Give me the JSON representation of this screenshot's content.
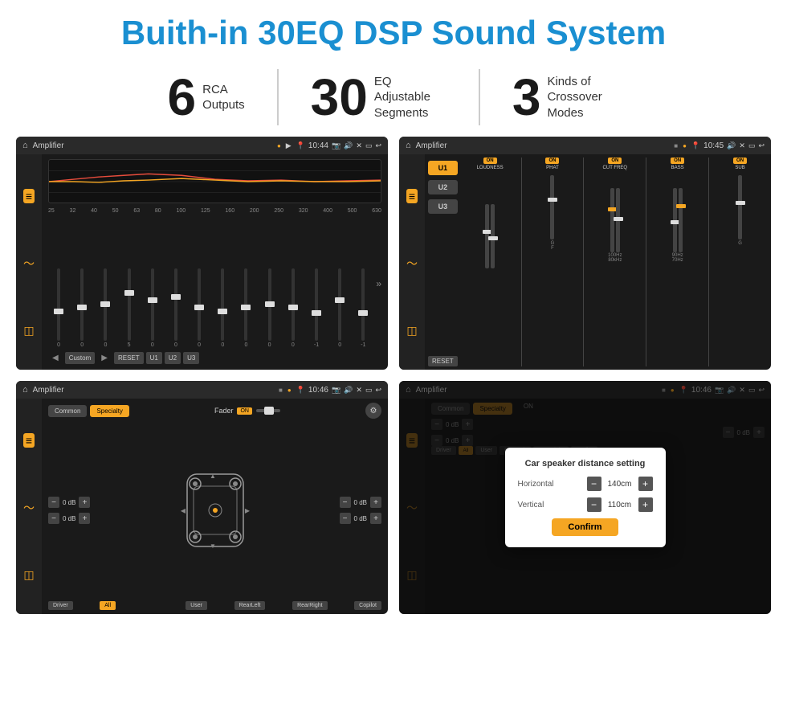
{
  "header": {
    "title": "Buith-in 30EQ DSP Sound System"
  },
  "stats": [
    {
      "number": "6",
      "label": "RCA\nOutputs"
    },
    {
      "number": "30",
      "label": "EQ Adjustable\nSegments"
    },
    {
      "number": "3",
      "label": "Kinds of\nCrossover Modes"
    }
  ],
  "screens": [
    {
      "id": "eq-screen",
      "topbar": {
        "title": "Amplifier",
        "time": "10:44"
      },
      "type": "eq"
    },
    {
      "id": "amp-screen",
      "topbar": {
        "title": "Amplifier",
        "time": "10:45"
      },
      "type": "amplifier"
    },
    {
      "id": "crossover-screen",
      "topbar": {
        "title": "Amplifier",
        "time": "10:46"
      },
      "type": "crossover"
    },
    {
      "id": "dialog-screen",
      "topbar": {
        "title": "Amplifier",
        "time": "10:46"
      },
      "type": "dialog"
    }
  ],
  "eq": {
    "frequencies": [
      "25",
      "32",
      "40",
      "50",
      "63",
      "80",
      "100",
      "125",
      "160",
      "200",
      "250",
      "320",
      "400",
      "500",
      "630"
    ],
    "values": [
      "0",
      "0",
      "0",
      "5",
      "0",
      "0",
      "0",
      "0",
      "0",
      "0",
      "0",
      "-1",
      "0",
      "-1",
      ""
    ],
    "presets": [
      "Custom",
      "RESET",
      "U1",
      "U2",
      "U3"
    ]
  },
  "dialog": {
    "title": "Car speaker distance setting",
    "horizontal_label": "Horizontal",
    "horizontal_value": "140cm",
    "vertical_label": "Vertical",
    "vertical_value": "110cm",
    "confirm_label": "Confirm"
  },
  "crossover": {
    "tabs": [
      "Common",
      "Specialty"
    ],
    "fader_label": "Fader",
    "fader_on": "ON",
    "db_labels": [
      "0 dB",
      "0 dB",
      "0 dB",
      "0 dB"
    ],
    "bottom_buttons": [
      "Driver",
      "All",
      "User",
      "RearLeft",
      "RearRight",
      "Copilot"
    ]
  },
  "amplifier": {
    "u_buttons": [
      "U1",
      "U2",
      "U3"
    ],
    "channels": [
      "LOUDNESS",
      "PHAT",
      "CUT FREQ",
      "BASS",
      "SUB"
    ],
    "reset": "RESET"
  }
}
